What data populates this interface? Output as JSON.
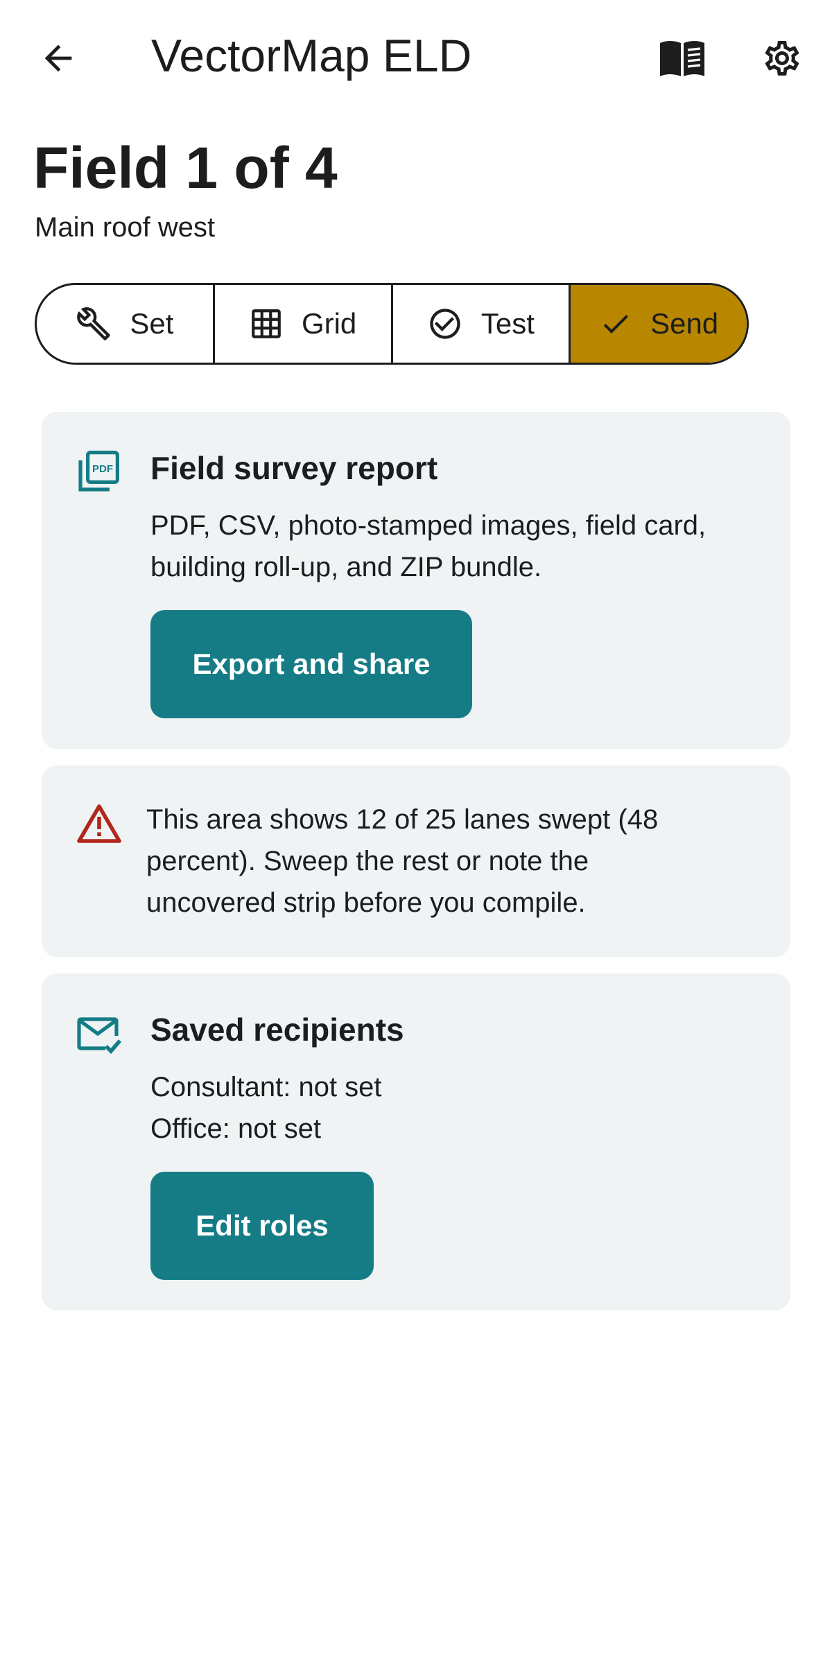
{
  "appbar": {
    "title": "VectorMap ELD",
    "icons": {
      "back": "arrow-left-icon",
      "manual": "open-book-icon",
      "settings": "gear-icon"
    }
  },
  "header": {
    "title": "Field 1 of 4",
    "subtitle": "Main roof west"
  },
  "stepper": {
    "steps": [
      {
        "label": "Set",
        "icon": "wrench-icon",
        "active": false
      },
      {
        "label": "Grid",
        "icon": "grid-icon",
        "active": false
      },
      {
        "label": "Test",
        "icon": "check-circle-icon",
        "active": false
      },
      {
        "label": "Send",
        "icon": "check-icon",
        "active": true
      }
    ]
  },
  "report_card": {
    "icon": "pdf-stack-icon",
    "icon_text": "PDF",
    "title": "Field survey report",
    "description_line1": "PDF, CSV, photo-stamped images, field card,",
    "description_line2": "building roll-up, and ZIP bundle.",
    "button_label": "Export and share"
  },
  "warning_card": {
    "icon": "warning-triangle-icon",
    "line1": "This area shows 12 of 25 lanes swept (48",
    "line2": "percent). Sweep the rest or note the",
    "line3": "uncovered strip before you compile."
  },
  "recipients_card": {
    "icon": "mail-check-icon",
    "title": "Saved recipients",
    "consultant": "Consultant: not set",
    "office": "Office: not set",
    "button_label": "Edit roles"
  },
  "colors": {
    "accent": "#157c86",
    "active_step": "#b98600",
    "warning": "#b3261e",
    "card_bg": "#eff3f4",
    "text": "#1b1d1f"
  }
}
